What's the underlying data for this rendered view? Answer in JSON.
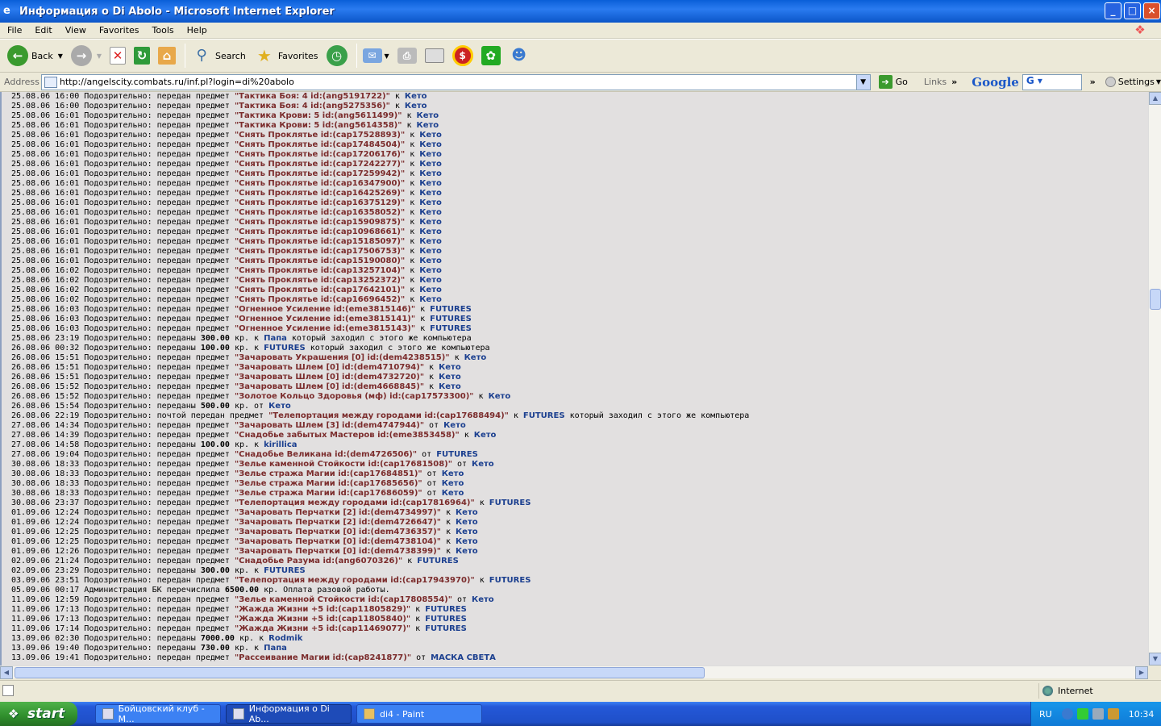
{
  "window": {
    "title": "Информация о Di Abolo - Microsoft Internet Explorer",
    "minimize": "_",
    "maximize": "□",
    "close": "×"
  },
  "menu": [
    "File",
    "Edit",
    "View",
    "Favorites",
    "Tools",
    "Help"
  ],
  "toolbar": {
    "back_label": "Back",
    "search_label": "Search",
    "favorites_label": "Favorites"
  },
  "address": {
    "label": "Address",
    "url": "http://angelscity.combats.ru/inf.pl?login=di%20abolo",
    "go_label": "Go",
    "links_label": "Links",
    "google_label": "Google",
    "google_select": "G",
    "settings_label": "Settings"
  },
  "log": [
    {
      "t": "25.08.06 16:00 Подозрительно: передан предмет ",
      "item": "\"Тактика Боя: 4 id:(ang5191722)\"",
      "dir": " к ",
      "name": "Кето"
    },
    {
      "t": "25.08.06 16:00 Подозрительно: передан предмет ",
      "item": "\"Тактика Боя: 4 id:(ang5275356)\"",
      "dir": " к ",
      "name": "Кето"
    },
    {
      "t": "25.08.06 16:01 Подозрительно: передан предмет ",
      "item": "\"Тактика Крови: 5 id:(ang5611499)\"",
      "dir": " к ",
      "name": "Кето"
    },
    {
      "t": "25.08.06 16:01 Подозрительно: передан предмет ",
      "item": "\"Тактика Крови: 5 id:(ang5614358)\"",
      "dir": " к ",
      "name": "Кето"
    },
    {
      "t": "25.08.06 16:01 Подозрительно: передан предмет ",
      "item": "\"Снять Проклятье id:(cap17528893)\"",
      "dir": " к ",
      "name": "Кето"
    },
    {
      "t": "25.08.06 16:01 Подозрительно: передан предмет ",
      "item": "\"Снять Проклятье id:(cap17484504)\"",
      "dir": " к ",
      "name": "Кето"
    },
    {
      "t": "25.08.06 16:01 Подозрительно: передан предмет ",
      "item": "\"Снять Проклятье id:(cap17206176)\"",
      "dir": " к ",
      "name": "Кето"
    },
    {
      "t": "25.08.06 16:01 Подозрительно: передан предмет ",
      "item": "\"Снять Проклятье id:(cap17242277)\"",
      "dir": " к ",
      "name": "Кето"
    },
    {
      "t": "25.08.06 16:01 Подозрительно: передан предмет ",
      "item": "\"Снять Проклятье id:(cap17259942)\"",
      "dir": " к ",
      "name": "Кето"
    },
    {
      "t": "25.08.06 16:01 Подозрительно: передан предмет ",
      "item": "\"Снять Проклятье id:(cap16347900)\"",
      "dir": " к ",
      "name": "Кето"
    },
    {
      "t": "25.08.06 16:01 Подозрительно: передан предмет ",
      "item": "\"Снять Проклятье id:(cap16425269)\"",
      "dir": " к ",
      "name": "Кето"
    },
    {
      "t": "25.08.06 16:01 Подозрительно: передан предмет ",
      "item": "\"Снять Проклятье id:(cap16375129)\"",
      "dir": " к ",
      "name": "Кето"
    },
    {
      "t": "25.08.06 16:01 Подозрительно: передан предмет ",
      "item": "\"Снять Проклятье id:(cap16358052)\"",
      "dir": " к ",
      "name": "Кето"
    },
    {
      "t": "25.08.06 16:01 Подозрительно: передан предмет ",
      "item": "\"Снять Проклятье id:(cap15909875)\"",
      "dir": " к ",
      "name": "Кето"
    },
    {
      "t": "25.08.06 16:01 Подозрительно: передан предмет ",
      "item": "\"Снять Проклятье id:(cap10968661)\"",
      "dir": " к ",
      "name": "Кето"
    },
    {
      "t": "25.08.06 16:01 Подозрительно: передан предмет ",
      "item": "\"Снять Проклятье id:(cap15185097)\"",
      "dir": " к ",
      "name": "Кето"
    },
    {
      "t": "25.08.06 16:01 Подозрительно: передан предмет ",
      "item": "\"Снять Проклятье id:(cap17506753)\"",
      "dir": " к ",
      "name": "Кето"
    },
    {
      "t": "25.08.06 16:01 Подозрительно: передан предмет ",
      "item": "\"Снять Проклятье id:(cap15190080)\"",
      "dir": " к ",
      "name": "Кето"
    },
    {
      "t": "25.08.06 16:02 Подозрительно: передан предмет ",
      "item": "\"Снять Проклятье id:(cap13257104)\"",
      "dir": " к ",
      "name": "Кето"
    },
    {
      "t": "25.08.06 16:02 Подозрительно: передан предмет ",
      "item": "\"Снять Проклятье id:(cap13252372)\"",
      "dir": " к ",
      "name": "Кето"
    },
    {
      "t": "25.08.06 16:02 Подозрительно: передан предмет ",
      "item": "\"Снять Проклятье id:(cap17642101)\"",
      "dir": " к ",
      "name": "Кето"
    },
    {
      "t": "25.08.06 16:02 Подозрительно: передан предмет ",
      "item": "\"Снять Проклятье id:(cap16696452)\"",
      "dir": " к ",
      "name": "Кето"
    },
    {
      "t": "25.08.06 16:03 Подозрительно: передан предмет ",
      "item": "\"Огненное Усиление id:(eme3815146)\"",
      "dir": " к ",
      "name": "FUTURES"
    },
    {
      "t": "25.08.06 16:03 Подозрительно: передан предмет ",
      "item": "\"Огненное Усиление id:(eme3815141)\"",
      "dir": " к ",
      "name": "FUTURES"
    },
    {
      "t": "25.08.06 16:03 Подозрительно: передан предмет ",
      "item": "\"Огненное Усиление id:(eme3815143)\"",
      "dir": " к ",
      "name": "FUTURES"
    },
    {
      "t": "25.08.06 23:19 Подозрительно: переданы ",
      "amount": "300.00",
      "t2": " кр. к ",
      "name": "Папа",
      "tail": " который заходил с этого же компьютера"
    },
    {
      "t": "26.08.06 00:32 Подозрительно: переданы ",
      "amount": "100.00",
      "t2": " кр. к ",
      "name": "FUTURES",
      "tail": " который заходил с этого же компьютера"
    },
    {
      "t": "26.08.06 15:51 Подозрительно: передан предмет ",
      "item": "\"Зачаровать Украшения [0] id:(dem4238515)\"",
      "dir": " к ",
      "name": "Кето"
    },
    {
      "t": "26.08.06 15:51 Подозрительно: передан предмет ",
      "item": "\"Зачаровать Шлем [0] id:(dem4710794)\"",
      "dir": " к ",
      "name": "Кето"
    },
    {
      "t": "26.08.06 15:51 Подозрительно: передан предмет ",
      "item": "\"Зачаровать Шлем [0] id:(dem4732720)\"",
      "dir": " к ",
      "name": "Кето"
    },
    {
      "t": "26.08.06 15:52 Подозрительно: передан предмет ",
      "item": "\"Зачаровать Шлем [0] id:(dem4668845)\"",
      "dir": " к ",
      "name": "Кето"
    },
    {
      "t": "26.08.06 15:52 Подозрительно: передан предмет ",
      "item": "\"Золотое Кольцо Здоровья (мф) id:(cap17573300)\"",
      "dir": " к ",
      "name": "Кето"
    },
    {
      "t": "26.08.06 15:54 Подозрительно: переданы ",
      "amount": "500.00",
      "t2": " кр. от ",
      "name": "Кето"
    },
    {
      "t": "26.08.06 22:19 Подозрительно: почтой передан предмет ",
      "item": "\"Телепортация между городами id:(cap17688494)\"",
      "dir": " к ",
      "name": "FUTURES",
      "tail": " который заходил с этого же компьютера"
    },
    {
      "t": "27.08.06 14:34 Подозрительно: передан предмет ",
      "item": "\"Зачаровать Шлем [3] id:(dem4747944)\"",
      "dir": " от ",
      "name": "Кето"
    },
    {
      "t": "27.08.06 14:39 Подозрительно: передан предмет ",
      "item": "\"Снадобье забытых Мастеров id:(eme3853458)\"",
      "dir": " к ",
      "name": "Кето"
    },
    {
      "t": "27.08.06 14:58 Подозрительно: переданы ",
      "amount": "100.00",
      "t2": " кр. к ",
      "name": "kirillica"
    },
    {
      "t": "27.08.06 19:04 Подозрительно: передан предмет ",
      "item": "\"Снадобье Великана id:(dem4726506)\"",
      "dir": " от ",
      "name": "FUTURES"
    },
    {
      "t": "30.08.06 18:33 Подозрительно: передан предмет ",
      "item": "\"Зелье каменной Стойкости id:(cap17681508)\"",
      "dir": " от ",
      "name": "Кето"
    },
    {
      "t": "30.08.06 18:33 Подозрительно: передан предмет ",
      "item": "\"Зелье стража Магии id:(cap17684851)\"",
      "dir": " от ",
      "name": "Кето"
    },
    {
      "t": "30.08.06 18:33 Подозрительно: передан предмет ",
      "item": "\"Зелье стража Магии id:(cap17685656)\"",
      "dir": " от ",
      "name": "Кето"
    },
    {
      "t": "30.08.06 18:33 Подозрительно: передан предмет ",
      "item": "\"Зелье стража Магии id:(cap17686059)\"",
      "dir": " от ",
      "name": "Кето"
    },
    {
      "t": "30.08.06 23:37 Подозрительно: передан предмет ",
      "item": "\"Телепортация между городами id:(cap17816964)\"",
      "dir": " к ",
      "name": "FUTURES"
    },
    {
      "t": "01.09.06 12:24 Подозрительно: передан предмет ",
      "item": "\"Зачаровать Перчатки [2] id:(dem4734997)\"",
      "dir": " к ",
      "name": "Кето"
    },
    {
      "t": "01.09.06 12:24 Подозрительно: передан предмет ",
      "item": "\"Зачаровать Перчатки [2] id:(dem4726647)\"",
      "dir": " к ",
      "name": "Кето"
    },
    {
      "t": "01.09.06 12:25 Подозрительно: передан предмет ",
      "item": "\"Зачаровать Перчатки [0] id:(dem4736357)\"",
      "dir": " к ",
      "name": "Кето"
    },
    {
      "t": "01.09.06 12:25 Подозрительно: передан предмет ",
      "item": "\"Зачаровать Перчатки [0] id:(dem4738104)\"",
      "dir": " к ",
      "name": "Кето"
    },
    {
      "t": "01.09.06 12:26 Подозрительно: передан предмет ",
      "item": "\"Зачаровать Перчатки [0] id:(dem4738399)\"",
      "dir": " к ",
      "name": "Кето"
    },
    {
      "t": "02.09.06 21:24 Подозрительно: передан предмет ",
      "item": "\"Снадобье Разума id:(ang6070326)\"",
      "dir": " к ",
      "name": "FUTURES"
    },
    {
      "t": "02.09.06 23:29 Подозрительно: переданы ",
      "amount": "300.00",
      "t2": " кр. к ",
      "name": "FUTURES"
    },
    {
      "t": "03.09.06 23:51 Подозрительно: передан предмет ",
      "item": "\"Телепортация между городами id:(cap17943970)\"",
      "dir": " к ",
      "name": "FUTURES"
    },
    {
      "t": "05.09.06 00:17 Администрация БК перечислила ",
      "amount": "6500.00",
      "t2": " кр. Оплата разовой работы."
    },
    {
      "t": "11.09.06 12:59 Подозрительно: передан предмет ",
      "item": "\"Зелье каменной Стойкости id:(cap17808554)\"",
      "dir": " от ",
      "name": "Кето"
    },
    {
      "t": "11.09.06 17:13 Подозрительно: передан предмет ",
      "item": "\"Жажда Жизни +5 id:(cap11805829)\"",
      "dir": " к ",
      "name": "FUTURES"
    },
    {
      "t": "11.09.06 17:13 Подозрительно: передан предмет ",
      "item": "\"Жажда Жизни +5 id:(cap11805840)\"",
      "dir": " к ",
      "name": "FUTURES"
    },
    {
      "t": "11.09.06 17:14 Подозрительно: передан предмет ",
      "item": "\"Жажда Жизни +5 id:(cap11469077)\"",
      "dir": " к ",
      "name": "FUTURES"
    },
    {
      "t": "13.09.06 02:30 Подозрительно: переданы ",
      "amount": "7000.00",
      "t2": " кр. к ",
      "name": "Rodmik"
    },
    {
      "t": "13.09.06 19:40 Подозрительно: переданы ",
      "amount": "730.00",
      "t2": " кр. к ",
      "name": "Папа"
    },
    {
      "t": "13.09.06 19:41 Подозрительно: передан предмет ",
      "item": "\"Рассеивание Магии id:(cap8241877)\"",
      "dir": " от ",
      "name": "МАСКА СВЕТА"
    }
  ],
  "status": {
    "zone": "Internet"
  },
  "taskbar": {
    "start": "start",
    "tasks": [
      "Бойцовский клуб - M...",
      "Информация о Di Ab...",
      "di4 - Paint"
    ],
    "lang": "RU",
    "clock": "10:34"
  }
}
